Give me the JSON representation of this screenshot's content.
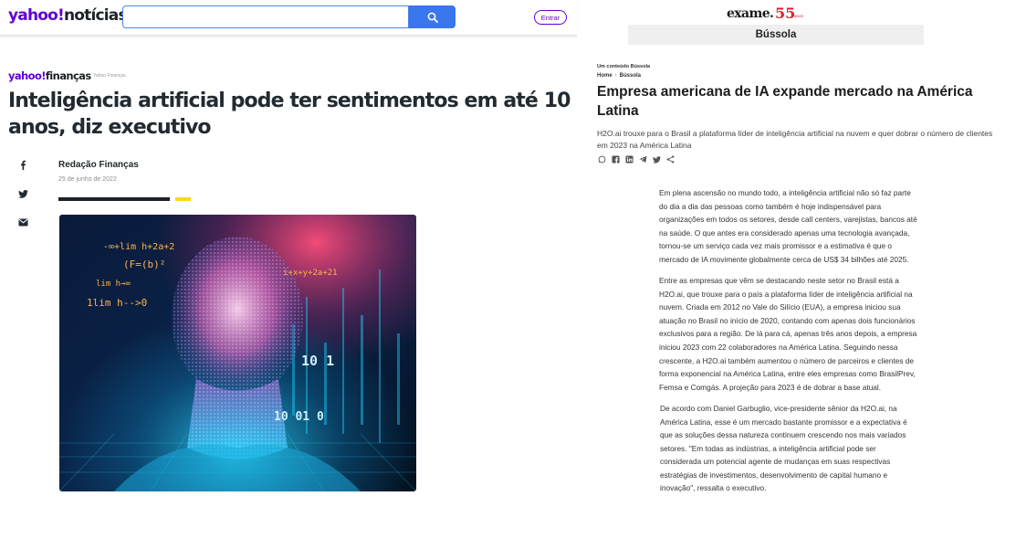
{
  "yahoo": {
    "header": {
      "logo_brand": "yahoo!",
      "logo_section": "notícias",
      "search_placeholder": "",
      "search_button_icon": "search-icon",
      "enter_label": "Entrar"
    },
    "article": {
      "brand_name": "yahoo!",
      "brand_section": "finanças",
      "source_note": "Yahoo Finanças",
      "title": "Inteligência artificial pode ter sentimentos em até 10 anos, diz executivo",
      "author": "Redação Finanças",
      "date": "25 de junho de 2022",
      "share_icons": [
        "facebook-icon",
        "twitter-icon",
        "mail-icon"
      ],
      "image_overlay_text": [
        "-∞+lim h+2a+2",
        "(F=(b)²",
        "lim h→∞",
        "1lim h-->0",
        "i+x+y+2a+21",
        "10 1",
        "10 01 0"
      ]
    }
  },
  "exame": {
    "logo_text": "exame.",
    "logo_number": "55",
    "logo_suffix": "anos",
    "section_bar": "Bússola",
    "kicker": "Um conteúdo Bússola",
    "breadcrumb": [
      "Home",
      "Bússola"
    ],
    "title": "Empresa americana de IA expande mercado na América Latina",
    "subtitle": "H2O.ai trouxe para o Brasil a plataforma líder de inteligência artificial na nuvem e quer dobrar o número de clientes em 2023 na América Latina",
    "share_icons": [
      "whatsapp-icon",
      "facebook-icon",
      "linkedin-icon",
      "telegram-icon",
      "twitter-icon",
      "share-icon"
    ],
    "paragraphs": [
      "Em plena ascensão no mundo todo, a inteligência artificial não só faz parte do dia a dia das pessoas como também é hoje indispensável para organizações em todos os setores, desde call centers, varejistas, bancos até na saúde. O que antes era considerado apenas uma tecnologia avançada, tornou-se um serviço cada vez mais promissor e a estimativa é que o mercado de IA movimente globalmente cerca de US$ 34 bilhões até 2025.",
      "Entre as empresas que vêm se destacando neste setor no Brasil está a H2O.ai, que trouxe para o país a plataforma líder de inteligência artificial na nuvem. Criada em 2012 no Vale do Silício (EUA), a empresa iniciou sua atuação no Brasil no início de 2020, contando com apenas dois funcionários exclusivos para a região. De lá para cá, apenas três anos depois, a empresa iniciou 2023 com 22 colaboradores na América Latina. Seguindo nessa crescente, a H2O.ai também aumentou o número de parceiros e clientes de forma exponencial na América Latina, entre eles empresas como BrasilPrev, Femsa e Comgás. A projeção para 2023 é de dobrar a base atual.",
      "De acordo com Daniel Garbuglio, vice-presidente sênior da H2O.ai, na América Latina, esse é um mercado bastante promissor e a expectativa é que as soluções dessa natureza continuem crescendo nos mais variados setores. \"Em todas as indústrias, a inteligência artificial pode ser considerada um potencial agente de mudanças em suas respectivas estratégias de investimentos, desenvolvimento de capital humano e inovação\", ressalta o executivo."
    ]
  }
}
